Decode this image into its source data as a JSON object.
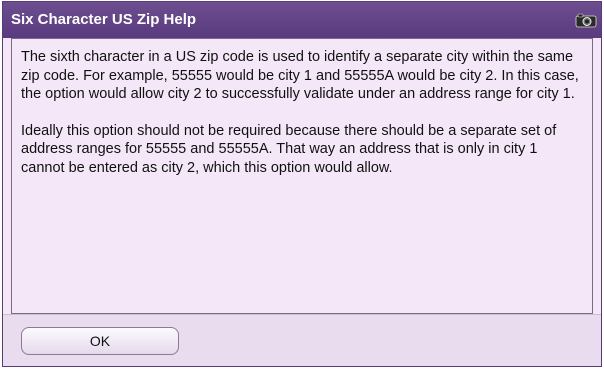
{
  "dialog": {
    "title": "Six Character US Zip Help",
    "title_icon": "camera-icon",
    "paragraphs": [
      "The sixth character in a US zip code is used to identify a separate city within the same zip code. For example, 55555 would be city 1 and 55555A would be city 2. In this case, the option would allow city 2 to successfully validate under an address range for city 1.",
      "Ideally this option should not be required because there should be a separate set of address ranges for 55555 and 55555A. That way an address that is only in city 1 cannot be entered as city 2, which this option would allow."
    ],
    "ok_label": "OK"
  },
  "colors": {
    "titlebar": "#5a3a7e",
    "background": "#f4e8f8",
    "footer": "#e8dcee"
  }
}
